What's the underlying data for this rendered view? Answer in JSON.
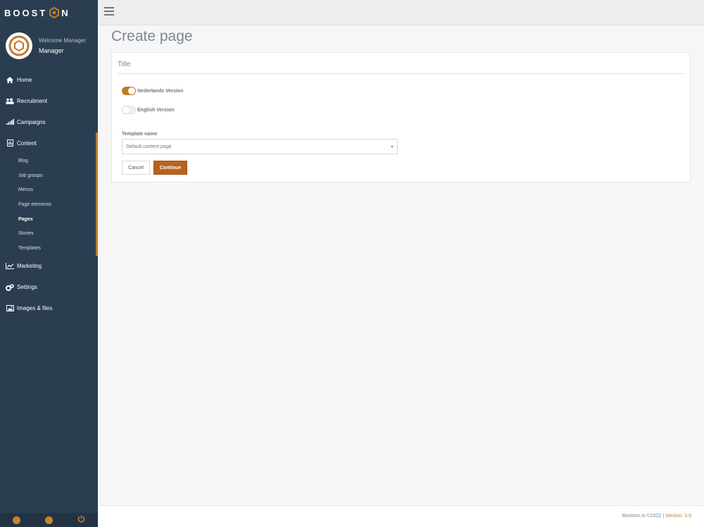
{
  "brand": {
    "prefix": "BOOST",
    "suffix": "N",
    "accent": "#c27a2a"
  },
  "profile": {
    "welcome": "Welcome Manager",
    "name": "Manager"
  },
  "sidebar": {
    "items": [
      {
        "label": "Home",
        "icon": "home-icon"
      },
      {
        "label": "Recruitment",
        "icon": "users-icon"
      },
      {
        "label": "Campaigns",
        "icon": "signal-bars-icon"
      },
      {
        "label": "Content",
        "icon": "document-icon"
      }
    ],
    "content_sub": [
      "Blog",
      "Job groups",
      "Menus",
      "Page elements",
      "Pages",
      "Stories",
      "Templates"
    ],
    "active_sub": "Pages",
    "items_after": [
      {
        "label": "Marketing",
        "icon": "line-chart-icon"
      },
      {
        "label": "Settings",
        "icon": "gears-icon"
      },
      {
        "label": "Images & files",
        "icon": "image-icon"
      }
    ]
  },
  "main": {
    "page_title": "Create page",
    "title_placeholder": "Title",
    "toggles": [
      {
        "label": "Nederlands Version",
        "on": true
      },
      {
        "label": "English Version",
        "on": false
      }
    ],
    "template_label": "Template name",
    "template_value": "Default content page",
    "cancel_label": "Cancel",
    "continue_label": "Continue"
  },
  "footer": {
    "copyright": "Booston.io ©2022 | ",
    "version": "Version: 3.0"
  }
}
